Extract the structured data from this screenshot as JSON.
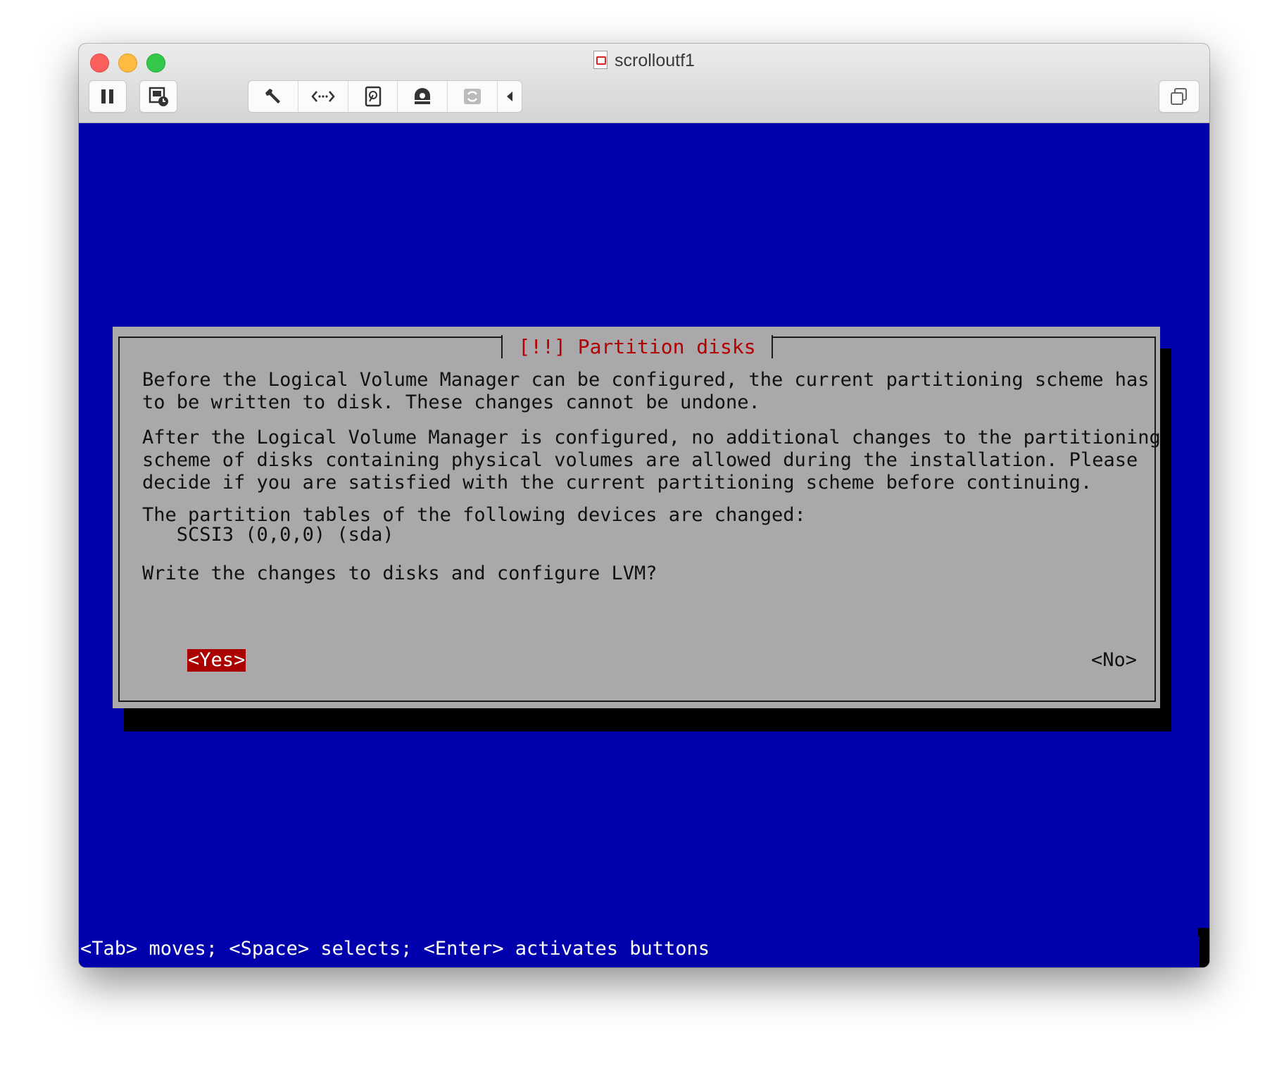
{
  "window": {
    "title": "scrolloutf1"
  },
  "toolbar": {
    "icons": [
      "pause-icon",
      "snapshot-icon",
      "settings-wrench-icon",
      "network-arrows-icon",
      "hard-disk-icon",
      "optical-drive-icon",
      "usb-sync-icon",
      "collapse-arrow-icon",
      "fullscreen-icon"
    ]
  },
  "dialog": {
    "title": "[!!] Partition disks",
    "para1": "Before the Logical Volume Manager can be configured, the current partitioning scheme has\nto be written to disk. These changes cannot be undone.",
    "para2": "After the Logical Volume Manager is configured, no additional changes to the partitioning\nscheme of disks containing physical volumes are allowed during the installation. Please\ndecide if you are satisfied with the current partitioning scheme before continuing.",
    "para3": "The partition tables of the following devices are changed:",
    "device": "   SCSI3 (0,0,0) (sda)",
    "question": "Write the changes to disks and configure LVM?",
    "yes_label": "<Yes>",
    "no_label": "<No>"
  },
  "status": {
    "hint": "<Tab> moves; <Space> selects; <Enter> activates buttons"
  },
  "colors": {
    "console_bg": "#0000ad",
    "dialog_bg": "#aaa8ab",
    "title_red": "#b30000",
    "button_selected": "#aa0000"
  }
}
